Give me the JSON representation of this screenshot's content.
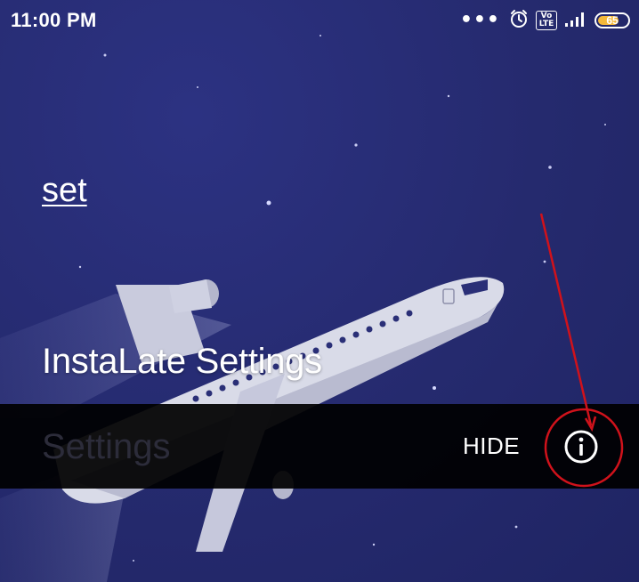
{
  "status_bar": {
    "time": "11:00 PM",
    "more_dots": "•••",
    "volte_label": "Vo LTE",
    "battery_level": "65",
    "icons": [
      "alarm-icon",
      "volte-icon",
      "signal-icon",
      "battery-icon"
    ]
  },
  "menu": {
    "set_label": "set",
    "instalate_label": "InstaLate Settings",
    "settings_label": "Settings"
  },
  "snackbar": {
    "hide_label": "HIDE",
    "info_icon": "info-icon"
  },
  "colors": {
    "background": "#2a2f77",
    "snackbar": "#000000",
    "annotation": "#d0121b",
    "battery_fill": "#f5b93a"
  }
}
